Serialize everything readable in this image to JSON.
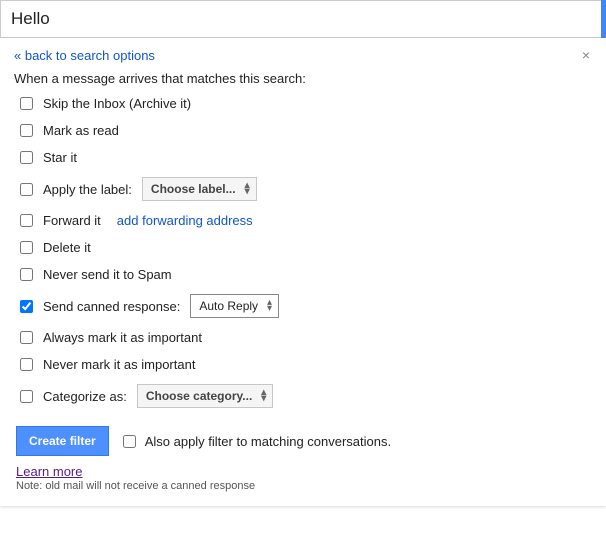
{
  "search": {
    "query": "Hello"
  },
  "back_link": "« back to search options",
  "intro": "When a message arrives that matches this search:",
  "options": {
    "skip_inbox": {
      "label": "Skip the Inbox (Archive it)",
      "checked": false
    },
    "mark_read": {
      "label": "Mark as read",
      "checked": false
    },
    "star": {
      "label": "Star it",
      "checked": false
    },
    "apply_label": {
      "label": "Apply the label:",
      "checked": false,
      "dropdown": "Choose label..."
    },
    "forward": {
      "label": "Forward it",
      "checked": false,
      "link": "add forwarding address"
    },
    "delete": {
      "label": "Delete it",
      "checked": false
    },
    "never_spam": {
      "label": "Never send it to Spam",
      "checked": false
    },
    "canned": {
      "label": "Send canned response:",
      "checked": true,
      "dropdown": "Auto Reply"
    },
    "always_important": {
      "label": "Always mark it as important",
      "checked": false
    },
    "never_important": {
      "label": "Never mark it as important",
      "checked": false
    },
    "categorize": {
      "label": "Categorize as:",
      "checked": false,
      "dropdown": "Choose category..."
    }
  },
  "footer": {
    "create_button": "Create filter",
    "also_apply": "Also apply filter to matching conversations."
  },
  "learn_more": "Learn more",
  "note": "Note: old mail will not receive a canned response"
}
